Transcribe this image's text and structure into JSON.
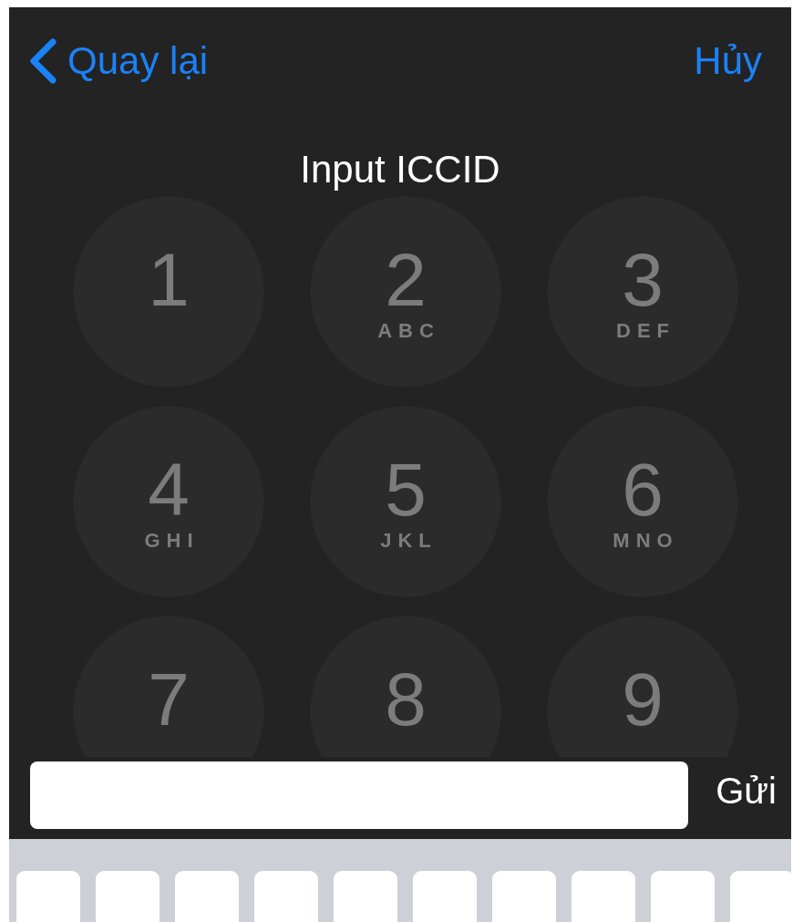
{
  "nav": {
    "back": "Quay lại",
    "cancel": "Hủy"
  },
  "title": "Input ICCID",
  "keypad": [
    {
      "digit": "1"
    },
    {
      "digit": "2",
      "letters": "ABC"
    },
    {
      "digit": "3",
      "letters": "DEF"
    },
    {
      "digit": "4",
      "letters": "GHI"
    },
    {
      "digit": "5",
      "letters": "JKL"
    },
    {
      "digit": "6",
      "letters": "MNO"
    },
    {
      "digit": "7"
    },
    {
      "digit": "8"
    },
    {
      "digit": "9"
    }
  ],
  "input": {
    "send": "Gửi"
  }
}
